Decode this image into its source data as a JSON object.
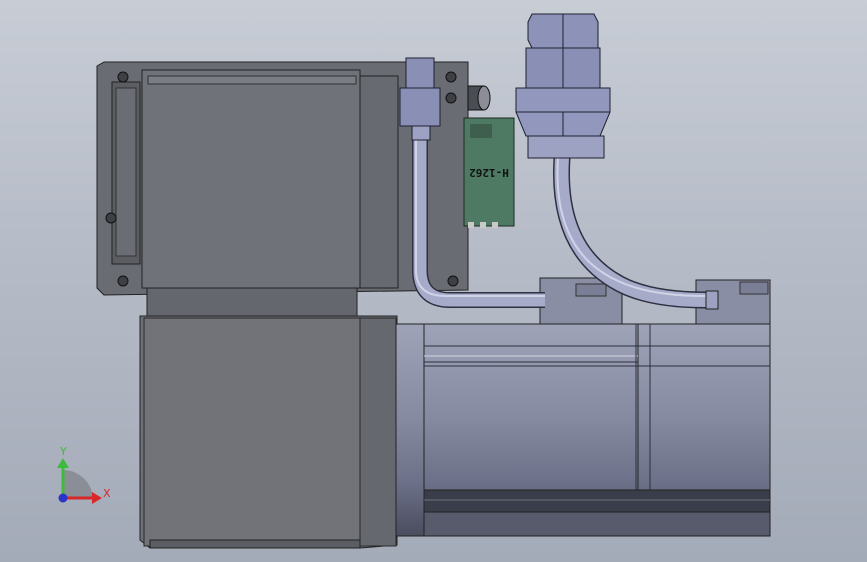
{
  "viewport": {
    "title": "",
    "background_top": "#c7ccd5",
    "background_bottom": "#a4abb8"
  },
  "model": {
    "pcb_label": "H-1262"
  },
  "triad": {
    "x_label": "X",
    "y_label": "Y",
    "x_color": "#d8282a",
    "y_color": "#3dbb3d",
    "z_color": "#2a35c8"
  },
  "colors": {
    "gear_body": "#6f7178",
    "gear_dark": "#55575d",
    "motor_body": "#858ba3",
    "motor_dark": "#3a3d4a",
    "cable": "#9fa4c4",
    "connector": "#8a8fb6",
    "pcb": "#4e7a64"
  }
}
